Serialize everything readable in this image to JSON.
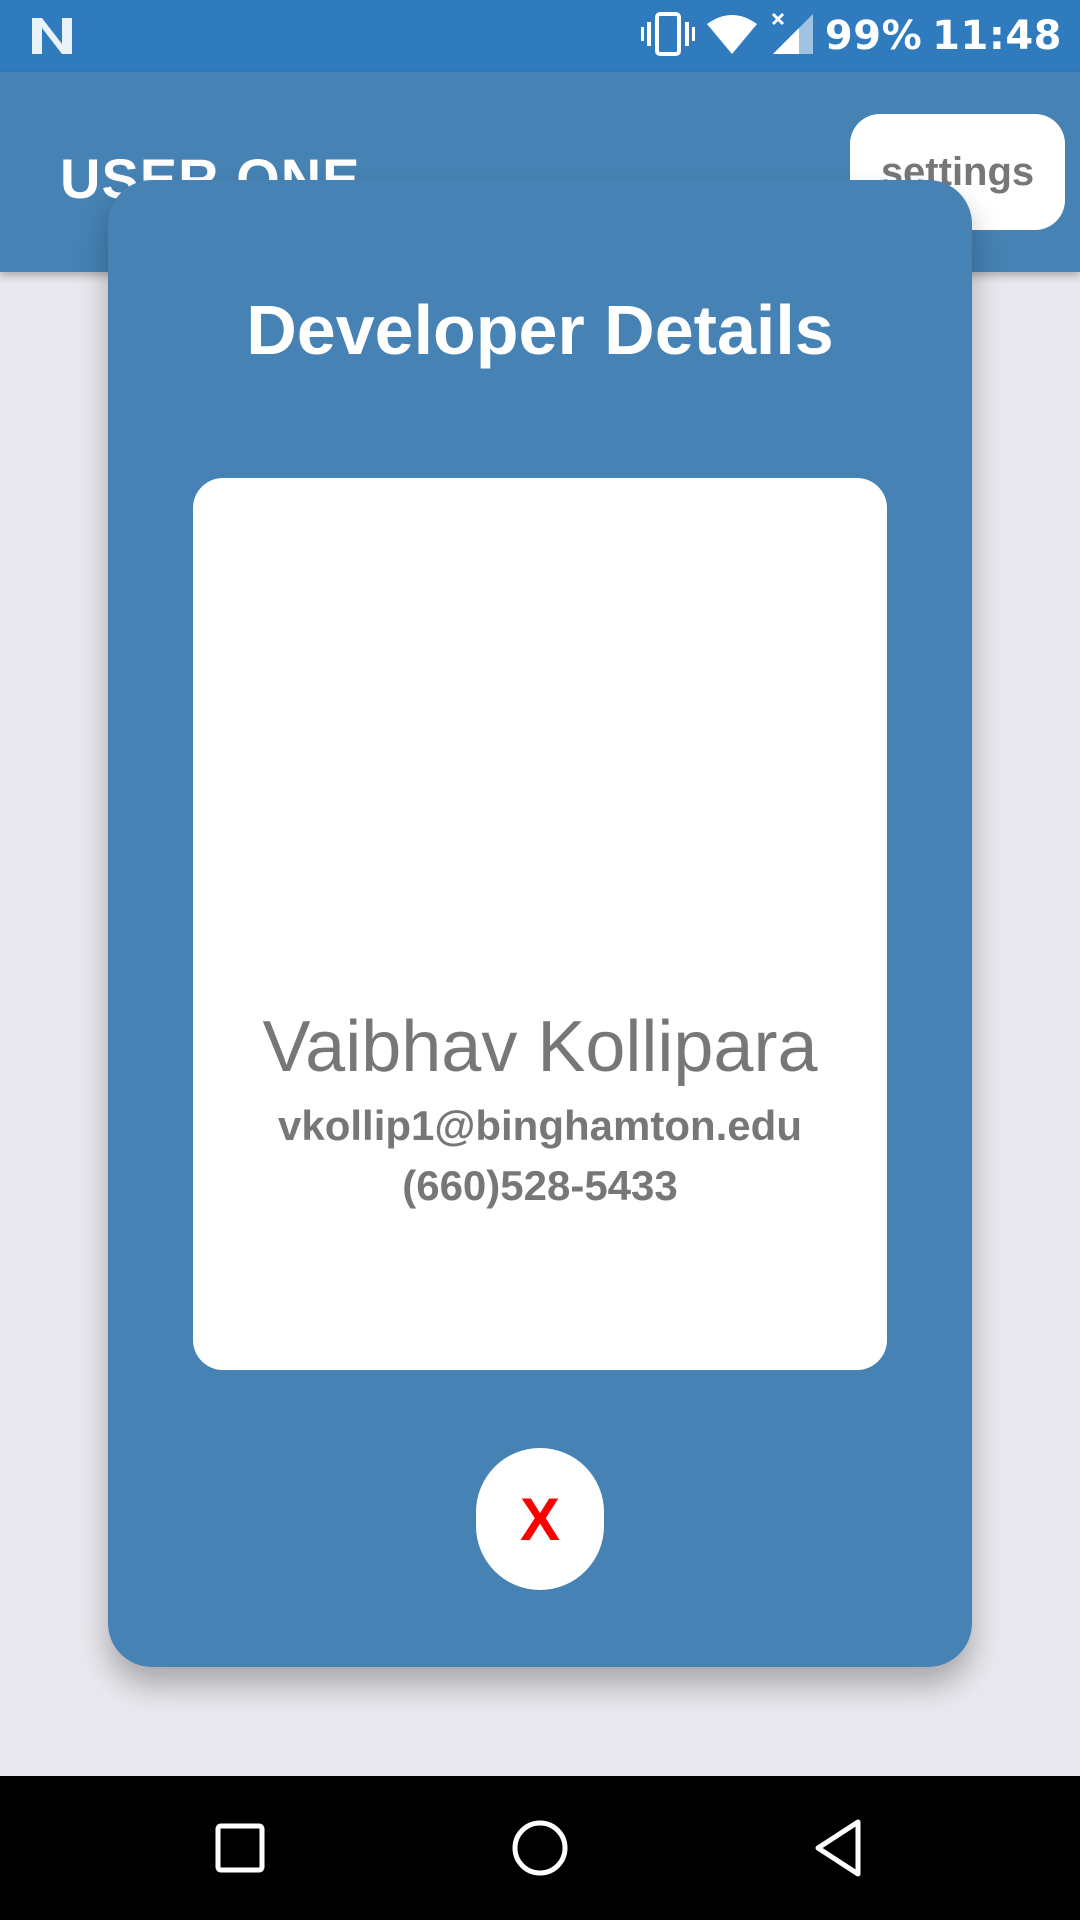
{
  "status_bar": {
    "battery": "99%",
    "time": "11:48",
    "icons": [
      "notification-n-icon",
      "vibrate-icon",
      "wifi-icon",
      "signal-icon"
    ]
  },
  "app_bar": {
    "title": "USER ONE",
    "settings_label": "settings"
  },
  "modal": {
    "title": "Developer Details",
    "name": "Vaibhav Kollipara",
    "email": "vkollip1@binghamton.edu",
    "phone": "(660)528-5433",
    "close_label": "X"
  },
  "colors": {
    "status_bar": "#2f7bbd",
    "primary": "#4682b4",
    "background": "#e8e8ee",
    "close_accent": "#ff0000"
  },
  "nav_bar": {
    "icons": [
      "recents-icon",
      "home-icon",
      "back-icon"
    ]
  }
}
